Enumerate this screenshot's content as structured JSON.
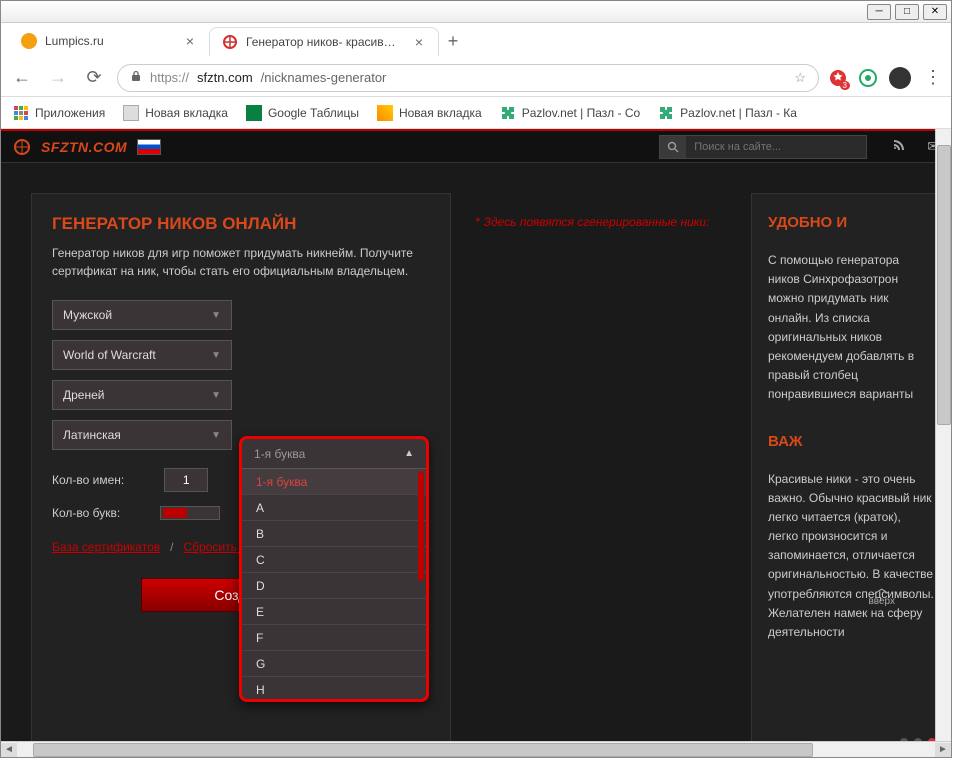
{
  "browser": {
    "tabs": [
      {
        "title": "Lumpics.ru",
        "favicon": "#f4a010"
      },
      {
        "title": "Генератор ников- красивые ни",
        "favicon": "#333"
      }
    ],
    "nav": {
      "back": "←",
      "fwd": "→",
      "reload": "⟳"
    },
    "url": {
      "proto": "https://",
      "host": "sfztn.com",
      "path": "/nicknames-generator"
    },
    "ext_badge": "3",
    "bookmarks": [
      {
        "icon": "grid",
        "label": "Приложения"
      },
      {
        "icon": "gray",
        "label": "Новая вкладка"
      },
      {
        "icon": "green",
        "label": "Google Таблицы"
      },
      {
        "icon": "orange",
        "label": "Новая вкладка"
      },
      {
        "icon": "puzzle",
        "label": "Pazlov.net | Пазл - Со"
      },
      {
        "icon": "puzzle",
        "label": "Pazlov.net | Пазл - Ка"
      }
    ]
  },
  "site": {
    "logo": "SFZTN.COM",
    "search_placeholder": "Поиск на сайте..."
  },
  "gen": {
    "title": "ГЕНЕРАТОР НИКОВ ОНЛАЙН",
    "desc": "Генератор ников для игр поможет придумать никнейм. Получите сертификат на ник, чтобы стать его официальным владельцем.",
    "selects": {
      "gender": "Мужской",
      "game": "World of Warcraft",
      "race": "Дреней",
      "alphabet": "Латинская"
    },
    "names_label": "Кол-во имен:",
    "names_value": "1",
    "letters_label": "Кол-во букв:",
    "link1": "База сертификатов",
    "link2": "Сбросить настройки",
    "create": "Создать"
  },
  "mid": {
    "placeholder": "Здесь появятся сгенерированные ники:"
  },
  "right": {
    "h1": "УДОБНО И",
    "p1": "С помощью генератора ников Синхрофазотрон можно придумать ник онлайн. Из списка оригинальных ников рекомендуем добавлять в правый столбец понравившиеся варианты",
    "h2": "ВАЖ",
    "p2": "Красивые ники - это очень важно. Обычно красивый ник легко читается (краток), легко произносится и запоминается, отличается оригинальностью. В качестве употребляются спецсимволы. Желателен намек на сферу деятельности"
  },
  "scroll_top": "вверх",
  "dropdown": {
    "header": "1-я буква",
    "items": [
      "1-я буква",
      "A",
      "B",
      "C",
      "D",
      "E",
      "F",
      "G",
      "H"
    ]
  }
}
